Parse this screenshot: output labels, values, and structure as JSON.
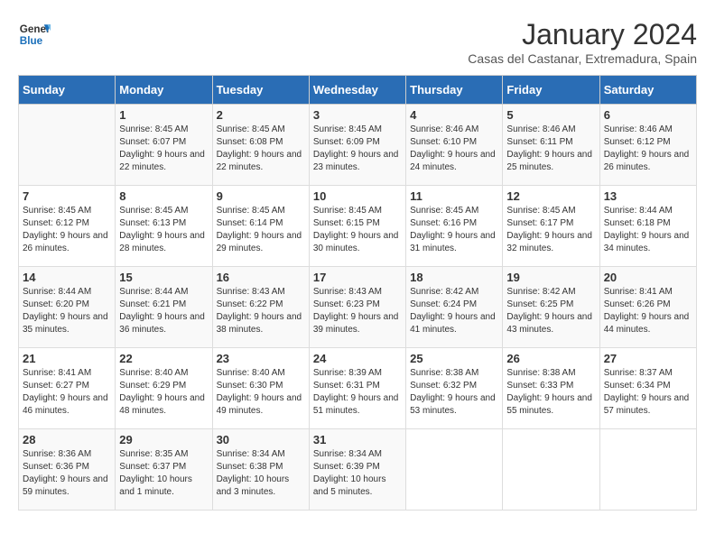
{
  "logo": {
    "line1": "General",
    "line2": "Blue"
  },
  "title": "January 2024",
  "location": "Casas del Castanar, Extremadura, Spain",
  "days_of_week": [
    "Sunday",
    "Monday",
    "Tuesday",
    "Wednesday",
    "Thursday",
    "Friday",
    "Saturday"
  ],
  "weeks": [
    [
      {
        "day": "",
        "sunrise": "",
        "sunset": "",
        "daylight": ""
      },
      {
        "day": "1",
        "sunrise": "Sunrise: 8:45 AM",
        "sunset": "Sunset: 6:07 PM",
        "daylight": "Daylight: 9 hours and 22 minutes."
      },
      {
        "day": "2",
        "sunrise": "Sunrise: 8:45 AM",
        "sunset": "Sunset: 6:08 PM",
        "daylight": "Daylight: 9 hours and 22 minutes."
      },
      {
        "day": "3",
        "sunrise": "Sunrise: 8:45 AM",
        "sunset": "Sunset: 6:09 PM",
        "daylight": "Daylight: 9 hours and 23 minutes."
      },
      {
        "day": "4",
        "sunrise": "Sunrise: 8:46 AM",
        "sunset": "Sunset: 6:10 PM",
        "daylight": "Daylight: 9 hours and 24 minutes."
      },
      {
        "day": "5",
        "sunrise": "Sunrise: 8:46 AM",
        "sunset": "Sunset: 6:11 PM",
        "daylight": "Daylight: 9 hours and 25 minutes."
      },
      {
        "day": "6",
        "sunrise": "Sunrise: 8:46 AM",
        "sunset": "Sunset: 6:12 PM",
        "daylight": "Daylight: 9 hours and 26 minutes."
      }
    ],
    [
      {
        "day": "7",
        "sunrise": "",
        "sunset": "",
        "daylight": ""
      },
      {
        "day": "8",
        "sunrise": "Sunrise: 8:45 AM",
        "sunset": "Sunset: 6:13 PM",
        "daylight": "Daylight: 9 hours and 28 minutes."
      },
      {
        "day": "9",
        "sunrise": "Sunrise: 8:45 AM",
        "sunset": "Sunset: 6:14 PM",
        "daylight": "Daylight: 9 hours and 29 minutes."
      },
      {
        "day": "10",
        "sunrise": "Sunrise: 8:45 AM",
        "sunset": "Sunset: 6:15 PM",
        "daylight": "Daylight: 9 hours and 30 minutes."
      },
      {
        "day": "11",
        "sunrise": "Sunrise: 8:45 AM",
        "sunset": "Sunset: 6:16 PM",
        "daylight": "Daylight: 9 hours and 31 minutes."
      },
      {
        "day": "12",
        "sunrise": "Sunrise: 8:45 AM",
        "sunset": "Sunset: 6:17 PM",
        "daylight": "Daylight: 9 hours and 32 minutes."
      },
      {
        "day": "13",
        "sunrise": "Sunrise: 8:44 AM",
        "sunset": "Sunset: 6:18 PM",
        "daylight": "Daylight: 9 hours and 34 minutes."
      }
    ],
    [
      {
        "day": "14",
        "sunrise": "",
        "sunset": "",
        "daylight": ""
      },
      {
        "day": "15",
        "sunrise": "Sunrise: 8:44 AM",
        "sunset": "Sunset: 6:21 PM",
        "daylight": "Daylight: 9 hours and 36 minutes."
      },
      {
        "day": "16",
        "sunrise": "Sunrise: 8:43 AM",
        "sunset": "Sunset: 6:22 PM",
        "daylight": "Daylight: 9 hours and 38 minutes."
      },
      {
        "day": "17",
        "sunrise": "Sunrise: 8:43 AM",
        "sunset": "Sunset: 6:23 PM",
        "daylight": "Daylight: 9 hours and 39 minutes."
      },
      {
        "day": "18",
        "sunrise": "Sunrise: 8:42 AM",
        "sunset": "Sunset: 6:24 PM",
        "daylight": "Daylight: 9 hours and 41 minutes."
      },
      {
        "day": "19",
        "sunrise": "Sunrise: 8:42 AM",
        "sunset": "Sunset: 6:25 PM",
        "daylight": "Daylight: 9 hours and 43 minutes."
      },
      {
        "day": "20",
        "sunrise": "Sunrise: 8:41 AM",
        "sunset": "Sunset: 6:26 PM",
        "daylight": "Daylight: 9 hours and 44 minutes."
      }
    ],
    [
      {
        "day": "21",
        "sunrise": "",
        "sunset": "",
        "daylight": ""
      },
      {
        "day": "22",
        "sunrise": "Sunrise: 8:40 AM",
        "sunset": "Sunset: 6:29 PM",
        "daylight": "Daylight: 9 hours and 48 minutes."
      },
      {
        "day": "23",
        "sunrise": "Sunrise: 8:40 AM",
        "sunset": "Sunset: 6:30 PM",
        "daylight": "Daylight: 9 hours and 49 minutes."
      },
      {
        "day": "24",
        "sunrise": "Sunrise: 8:39 AM",
        "sunset": "Sunset: 6:31 PM",
        "daylight": "Daylight: 9 hours and 51 minutes."
      },
      {
        "day": "25",
        "sunrise": "Sunrise: 8:38 AM",
        "sunset": "Sunset: 6:32 PM",
        "daylight": "Daylight: 9 hours and 53 minutes."
      },
      {
        "day": "26",
        "sunrise": "Sunrise: 8:38 AM",
        "sunset": "Sunset: 6:33 PM",
        "daylight": "Daylight: 9 hours and 55 minutes."
      },
      {
        "day": "27",
        "sunrise": "Sunrise: 8:37 AM",
        "sunset": "Sunset: 6:34 PM",
        "daylight": "Daylight: 9 hours and 57 minutes."
      }
    ],
    [
      {
        "day": "28",
        "sunrise": "",
        "sunset": "",
        "daylight": ""
      },
      {
        "day": "29",
        "sunrise": "Sunrise: 8:35 AM",
        "sunset": "Sunset: 6:37 PM",
        "daylight": "Daylight: 10 hours and 1 minute."
      },
      {
        "day": "30",
        "sunrise": "Sunrise: 8:34 AM",
        "sunset": "Sunset: 6:38 PM",
        "daylight": "Daylight: 10 hours and 3 minutes."
      },
      {
        "day": "31",
        "sunrise": "Sunrise: 8:34 AM",
        "sunset": "Sunset: 6:39 PM",
        "daylight": "Daylight: 10 hours and 5 minutes."
      },
      {
        "day": "",
        "sunrise": "",
        "sunset": "",
        "daylight": ""
      },
      {
        "day": "",
        "sunrise": "",
        "sunset": "",
        "daylight": ""
      },
      {
        "day": "",
        "sunrise": "",
        "sunset": "",
        "daylight": ""
      }
    ]
  ],
  "week1_sunday": {
    "sunrise": "",
    "sunset": "",
    "daylight": ""
  },
  "week2_sunday": {
    "sunrise": "Sunrise: 8:45 AM",
    "sunset": "Sunset: 6:12 PM",
    "daylight": "Daylight: 9 hours and 26 minutes."
  },
  "week3_sunday": {
    "sunrise": "Sunrise: 8:44 AM",
    "sunset": "Sunset: 6:20 PM",
    "daylight": "Daylight: 9 hours and 35 minutes."
  },
  "week4_sunday": {
    "sunrise": "Sunrise: 8:41 AM",
    "sunset": "Sunset: 6:27 PM",
    "daylight": "Daylight: 9 hours and 46 minutes."
  },
  "week5_sunday": {
    "sunrise": "Sunrise: 8:36 AM",
    "sunset": "Sunset: 6:36 PM",
    "daylight": "Daylight: 9 hours and 59 minutes."
  }
}
